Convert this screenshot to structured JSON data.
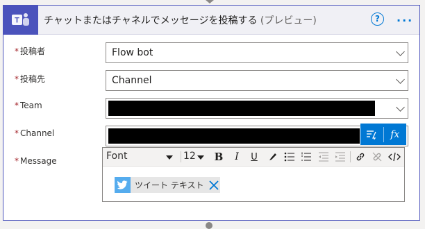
{
  "header": {
    "title": "チャットまたはチャネルでメッセージを投稿する",
    "title_suffix": "(プレビュー)",
    "help_label": "?",
    "more_label": "···"
  },
  "fields": {
    "poster": {
      "label": "投稿者",
      "value": "Flow bot"
    },
    "post_in": {
      "label": "投稿先",
      "value": "Channel"
    },
    "team": {
      "label": "Team"
    },
    "channel": {
      "label": "Channel"
    },
    "message": {
      "label": "Message"
    }
  },
  "required_marker": "*",
  "editor": {
    "font": "Font",
    "size": "12",
    "bold": "B",
    "italic": "I",
    "underline": "U",
    "token_label": "ツイート テキスト"
  },
  "dynamic_panel": {
    "fx_label": "fx"
  },
  "colors": {
    "accent": "#4b53bc",
    "link": "#0078d4",
    "required": "#a4262c",
    "twitter": "#55acee"
  }
}
